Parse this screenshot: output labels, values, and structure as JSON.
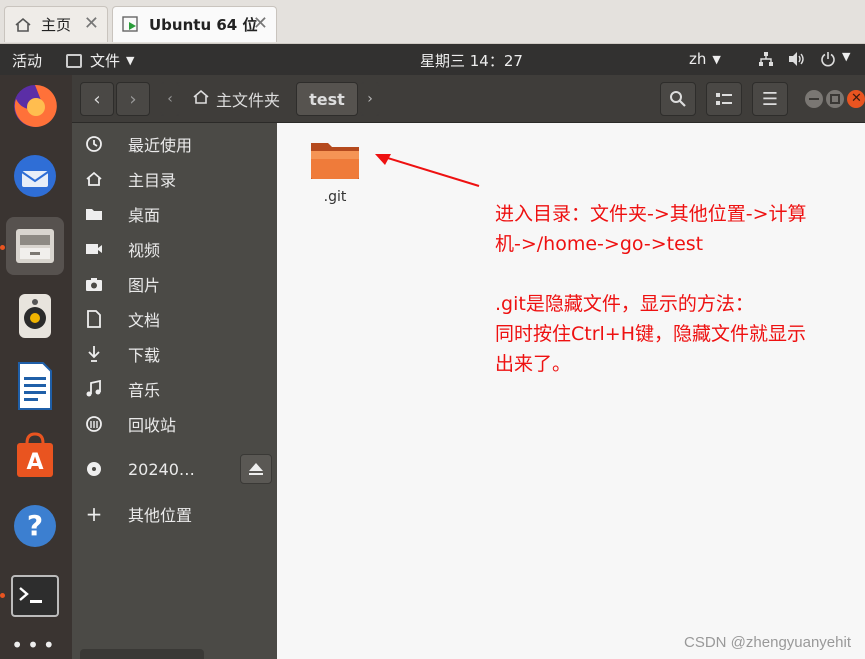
{
  "tabs": [
    {
      "label": "主页",
      "icon": "home-icon"
    },
    {
      "label": "Ubuntu 64 位",
      "icon": "vm-icon"
    }
  ],
  "topbar": {
    "activities": "活动",
    "app_menu": "文件",
    "clock": "星期三 14：27",
    "lang": "zh"
  },
  "header": {
    "breadcrumb_home": "主文件夹",
    "breadcrumb_current": "test"
  },
  "sidebar": {
    "items": [
      {
        "label": "最近使用",
        "icon": "clock-icon"
      },
      {
        "label": "主目录",
        "icon": "home-icon"
      },
      {
        "label": "桌面",
        "icon": "folder-icon"
      },
      {
        "label": "视频",
        "icon": "video-icon"
      },
      {
        "label": "图片",
        "icon": "camera-icon"
      },
      {
        "label": "文档",
        "icon": "document-icon"
      },
      {
        "label": "下载",
        "icon": "download-icon"
      },
      {
        "label": "音乐",
        "icon": "music-icon"
      },
      {
        "label": "回收站",
        "icon": "trash-icon"
      },
      {
        "label": "20240…",
        "icon": "disc-icon"
      },
      {
        "label": "其他位置",
        "icon": "plus-icon"
      }
    ]
  },
  "content": {
    "folder_name": ".git"
  },
  "annotation": {
    "line1": "进入目录：文件夹->其他位置->计算",
    "line2": "机->/home->go->test",
    "line3": ".git是隐藏文件，显示的方法：",
    "line4": "同时按住Ctrl+H键，隐藏文件就显示",
    "line5": "出来了。"
  },
  "watermark": "CSDN @zhengyuanyehit",
  "colors": {
    "accent": "#e95420",
    "annotation": "#ee1111"
  }
}
